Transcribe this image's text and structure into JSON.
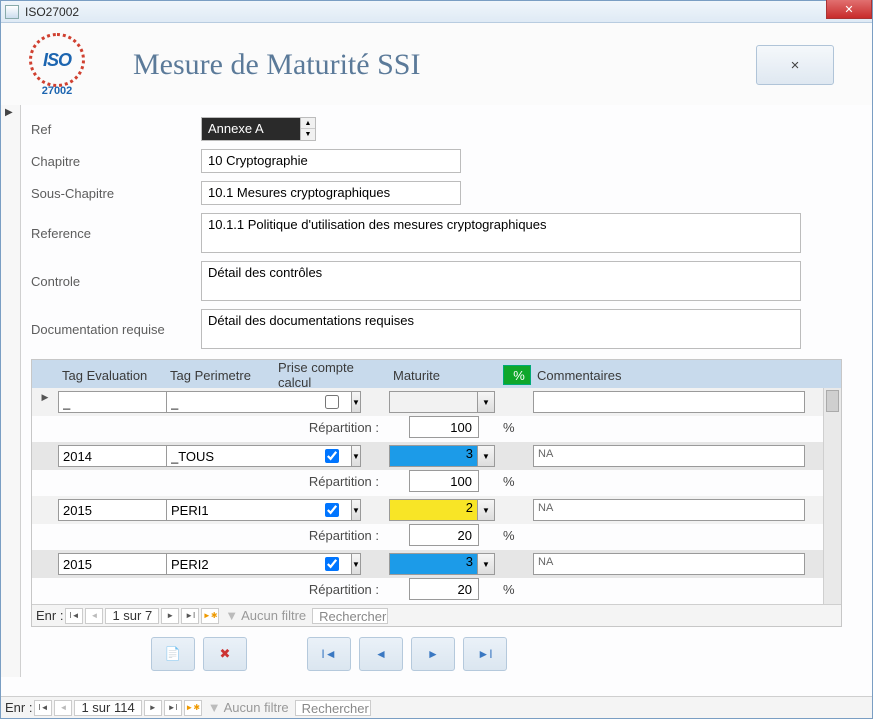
{
  "window": {
    "title": "ISO27002"
  },
  "iso": {
    "text": "ISO",
    "std": "27002"
  },
  "header": {
    "title": "Mesure de Maturité SSI",
    "close": "×"
  },
  "labels": {
    "ref": "Ref",
    "chapitre": "Chapitre",
    "sous_chapitre": "Sous-Chapitre",
    "reference": "Reference",
    "controle": "Controle",
    "doc_req": "Documentation requise"
  },
  "fields": {
    "ref": "Annexe A",
    "chapitre": "10 Cryptographie",
    "sous_chapitre": "10.1 Mesures cryptographiques",
    "reference": "10.1.1 Politique d'utilisation des mesures cryptographiques",
    "controle": "Détail des contrôles",
    "doc_req": "Détail des documentations requises"
  },
  "subform": {
    "headers": {
      "tag_eval": "Tag Evaluation",
      "tag_perim": "Tag Perimetre",
      "prise": "Prise compte calcul",
      "maturite": "Maturite",
      "pct_btn": "%",
      "comment": "Commentaires"
    },
    "rep_label": "Répartition :",
    "pct_sign": "%",
    "rows": [
      {
        "eval": "_",
        "perim": "_",
        "checked": false,
        "maturite": "",
        "mat_color": "",
        "rep": "100",
        "comment": ""
      },
      {
        "eval": "2014",
        "perim": "_TOUS",
        "checked": true,
        "maturite": "3",
        "mat_color": "bg-blue",
        "rep": "100",
        "comment": "NA"
      },
      {
        "eval": "2015",
        "perim": "PERI1",
        "checked": true,
        "maturite": "2",
        "mat_color": "bg-yellow",
        "rep": "20",
        "comment": "NA"
      },
      {
        "eval": "2015",
        "perim": "PERI2",
        "checked": true,
        "maturite": "3",
        "mat_color": "bg-blue",
        "rep": "20",
        "comment": "NA"
      }
    ],
    "nav": {
      "label": "Enr :",
      "pos": "1 sur 7",
      "filter": "Aucun filtre",
      "search": "Rechercher"
    }
  },
  "outer_nav": {
    "label": "Enr :",
    "pos": "1 sur 114",
    "filter": "Aucun filtre",
    "search": "Rechercher"
  }
}
